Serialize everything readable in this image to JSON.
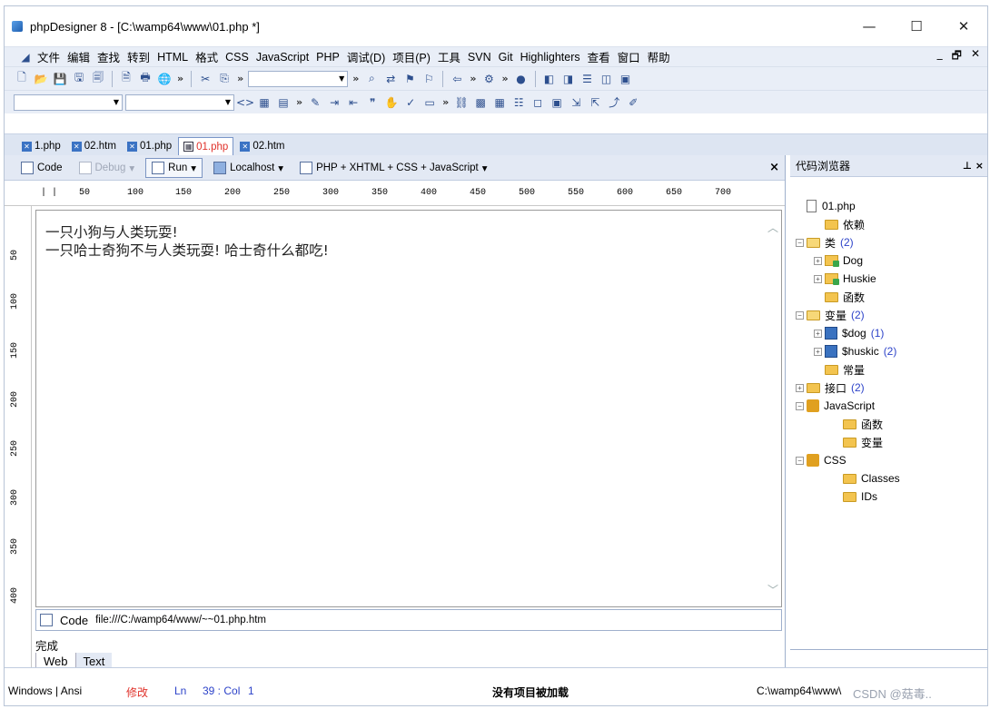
{
  "window": {
    "title": "phpDesigner 8 - [C:\\wamp64\\www\\01.php *]",
    "controls": [
      "—",
      "☐",
      "✕"
    ]
  },
  "menu": {
    "items": [
      "文件",
      "编辑",
      "查找",
      "转到",
      "HTML",
      "格式",
      "CSS",
      "JavaScript",
      "PHP",
      "调试(D)",
      "项目(P)",
      "工具",
      "SVN",
      "Git",
      "Highlighters",
      "查看",
      "窗口",
      "帮助"
    ],
    "right": [
      "_",
      "🗗",
      "✕"
    ]
  },
  "tabs": [
    {
      "label": "1.php",
      "active": false
    },
    {
      "label": "02.htm",
      "active": false
    },
    {
      "label": "01.php",
      "active": false
    },
    {
      "label": "01.php",
      "active": true
    },
    {
      "label": "02.htm",
      "active": false
    }
  ],
  "editor_toolbar": {
    "code": "Code",
    "debug": "Debug",
    "run": "Run",
    "localhost": "Localhost",
    "mode": "PHP + XHTML + CSS + JavaScript",
    "close": "×"
  },
  "ruler": {
    "h": [
      "50",
      "100",
      "150",
      "200",
      "250",
      "300",
      "350",
      "400",
      "450",
      "500",
      "550",
      "600",
      "650",
      "700"
    ],
    "v": [
      "50",
      "100",
      "150",
      "200",
      "250",
      "300",
      "350",
      "400"
    ]
  },
  "content": {
    "line1": "一只小狗与人类玩耍!",
    "line2": "一只哈士奇狗不与人类玩耍! 哈士奇什么都吃!"
  },
  "codebar": {
    "label": "Code",
    "url": "file:///C:/wamp64/www/~~01.php.htm"
  },
  "status_done": "完成",
  "view_tabs": {
    "web": "Web",
    "text": "Text"
  },
  "browser": {
    "title": "代码浏览器",
    "pin": "⊥ ×",
    "tree": [
      {
        "label": "01.php",
        "icon": "file",
        "level": 0,
        "exp": "",
        "count": ""
      },
      {
        "label": "依赖",
        "icon": "folder",
        "level": 1,
        "exp": "",
        "count": ""
      },
      {
        "label": "类",
        "icon": "folder-open",
        "level": 0,
        "exp": "−",
        "count": "(2)"
      },
      {
        "label": "Dog",
        "icon": "class",
        "level": 1,
        "exp": "+",
        "count": ""
      },
      {
        "label": "Huskie",
        "icon": "class",
        "level": 1,
        "exp": "+",
        "count": ""
      },
      {
        "label": "函数",
        "icon": "folder",
        "level": 1,
        "exp": "",
        "count": ""
      },
      {
        "label": "变量",
        "icon": "folder-open",
        "level": 0,
        "exp": "−",
        "count": "(2)"
      },
      {
        "label": "$dog",
        "icon": "var",
        "level": 1,
        "exp": "+",
        "count": "(1)"
      },
      {
        "label": "$huskic",
        "icon": "var",
        "level": 1,
        "exp": "+",
        "count": "(2)"
      },
      {
        "label": "常量",
        "icon": "folder",
        "level": 1,
        "exp": "",
        "count": ""
      },
      {
        "label": "接口",
        "icon": "folder",
        "level": 0,
        "exp": "+",
        "count": "(2)"
      },
      {
        "label": "JavaScript",
        "icon": "js",
        "level": 0,
        "exp": "−",
        "count": ""
      },
      {
        "label": "函数",
        "icon": "folder",
        "level": 2,
        "exp": "",
        "count": ""
      },
      {
        "label": "变量",
        "icon": "folder",
        "level": 2,
        "exp": "",
        "count": ""
      },
      {
        "label": "CSS",
        "icon": "js",
        "level": 0,
        "exp": "−",
        "count": ""
      },
      {
        "label": "Classes",
        "icon": "folder",
        "level": 2,
        "exp": "",
        "count": ""
      },
      {
        "label": "IDs",
        "icon": "folder",
        "level": 2,
        "exp": "",
        "count": ""
      }
    ]
  },
  "statusbar": {
    "encoding": "Windows | Ansi",
    "modified": "修改",
    "ln": "Ln",
    "pos": "39 : Col",
    "col": "1",
    "project": "没有项目被加载",
    "path": "C:\\wamp64\\www\\",
    "watermark": "CSDN @菇毒.."
  }
}
